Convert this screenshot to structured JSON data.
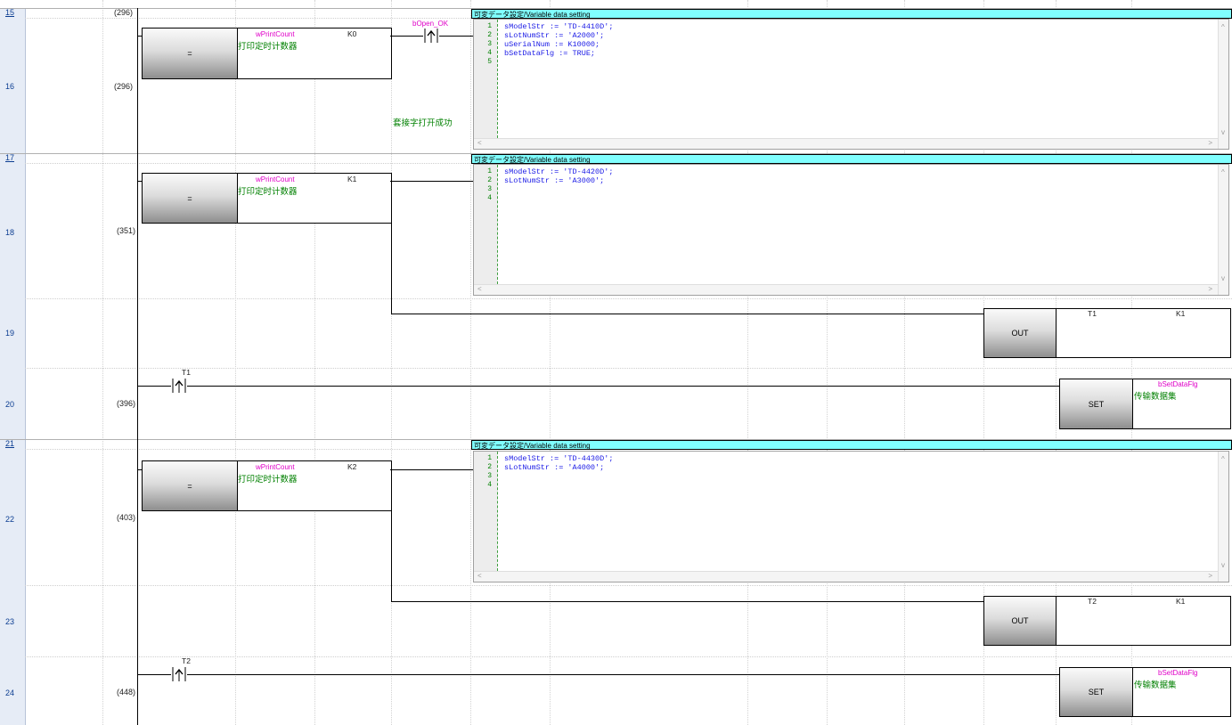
{
  "rows": [
    {
      "num": "15",
      "step": "(296)"
    },
    {
      "num": "16",
      "step": "(296)"
    },
    {
      "num": "17",
      "step": ""
    },
    {
      "num": "18",
      "step": "(351)"
    },
    {
      "num": "19",
      "step": ""
    },
    {
      "num": "20",
      "step": "(396)"
    },
    {
      "num": "21",
      "step": ""
    },
    {
      "num": "22",
      "step": "(403)"
    },
    {
      "num": "23",
      "step": ""
    },
    {
      "num": "24",
      "step": "(448)"
    }
  ],
  "compare_blocks": [
    {
      "op": "=",
      "device": "wPrintCount",
      "comment": "打印定时计数器",
      "constant": "K0"
    },
    {
      "op": "=",
      "device": "wPrintCount",
      "comment": "打印定时计数器",
      "constant": "K1"
    },
    {
      "op": "=",
      "device": "wPrintCount",
      "comment": "打印定时计数器",
      "constant": "K2"
    }
  ],
  "contact_bopen": {
    "device": "bOpen_OK",
    "comment": "套接字打开成功"
  },
  "timer_contacts": [
    {
      "device": "T1"
    },
    {
      "device": "T2"
    }
  ],
  "out_blocks": [
    {
      "op": "OUT",
      "device": "T1",
      "value": "K1"
    },
    {
      "op": "OUT",
      "device": "T2",
      "value": "K1"
    }
  ],
  "set_blocks": [
    {
      "op": "SET",
      "device": "bSetDataFlg",
      "comment": "传输数据集"
    },
    {
      "op": "SET",
      "device": "bSetDataFlg",
      "comment": "传输数据集"
    }
  ],
  "fbds": [
    {
      "header": "可変データ設定/Variable data setting",
      "lines": [
        {
          "n": "1",
          "code": "sModelStr := 'TD-4410D';"
        },
        {
          "n": "2",
          "code": "sLotNumStr := 'A2000';"
        },
        {
          "n": "3",
          "code": "uSerialNum := K10000;"
        },
        {
          "n": "4",
          "code": "bSetDataFlg := TRUE;"
        },
        {
          "n": "5",
          "code": ""
        }
      ]
    },
    {
      "header": "可変データ設定/Variable data setting",
      "lines": [
        {
          "n": "1",
          "code": "sModelStr := 'TD-4420D';"
        },
        {
          "n": "2",
          "code": "sLotNumStr := 'A3000';"
        },
        {
          "n": "3",
          "code": ""
        },
        {
          "n": "4",
          "code": ""
        }
      ]
    },
    {
      "header": "可変データ設定/Variable data setting",
      "lines": [
        {
          "n": "1",
          "code": "sModelStr := 'TD-4430D';"
        },
        {
          "n": "2",
          "code": "sLotNumStr := 'A4000';"
        },
        {
          "n": "3",
          "code": ""
        },
        {
          "n": "4",
          "code": ""
        }
      ]
    }
  ],
  "scroll_glyphs": {
    "left": "<",
    "right": ">",
    "up": "^",
    "down": "v"
  },
  "colors": {
    "device": "#e000c8",
    "comment": "#008000",
    "fbd_header": "#80ffff",
    "code": "#1a1ae6",
    "row_header": "#e6ecf6"
  }
}
